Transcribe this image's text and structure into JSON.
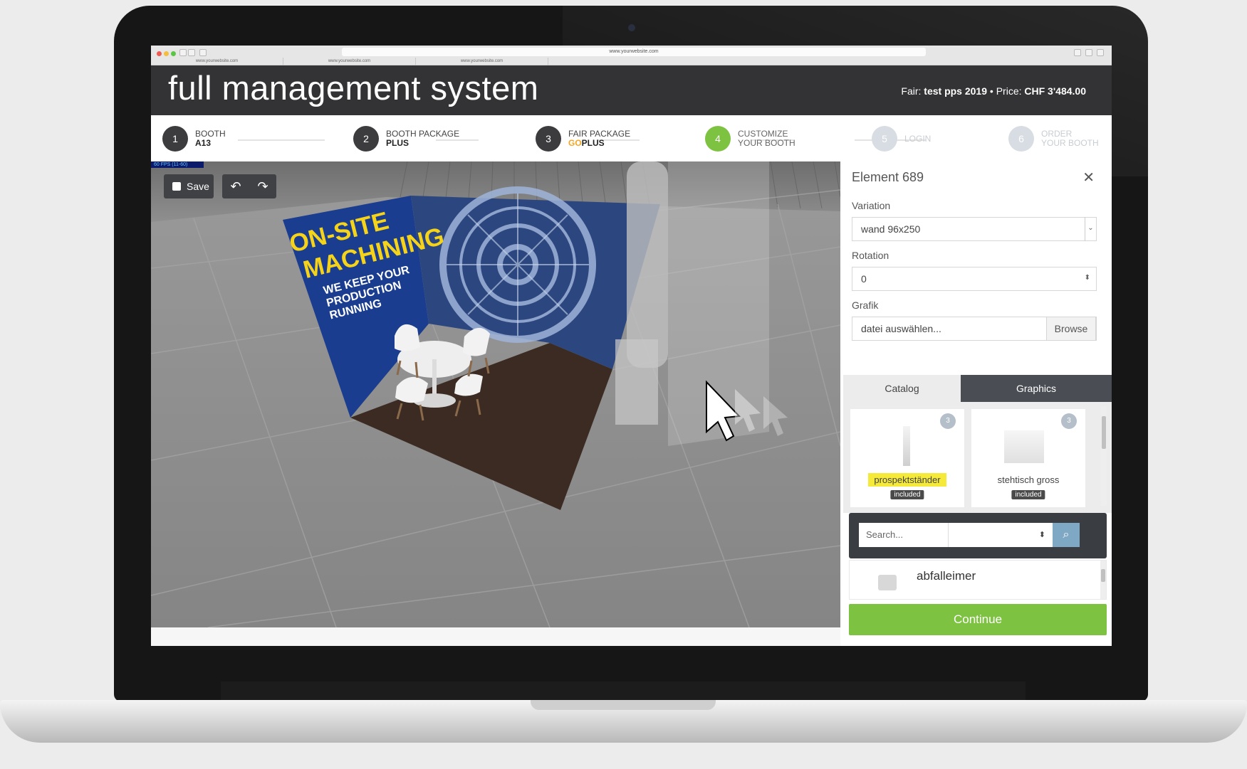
{
  "browser": {
    "url": "www.yourwebsite.com",
    "tabs": [
      "www.yourwebsite.com",
      "www.yourwebsite.com",
      "www.yourwebsite.com"
    ]
  },
  "header": {
    "title": "full management system",
    "fair_label": "Fair:",
    "fair_name": "test pps 2019",
    "separator": "•",
    "price_label": "Price:",
    "price": "CHF 3'484.00"
  },
  "steps": [
    {
      "num": "1",
      "label": "BOOTH",
      "sub": "A13",
      "state": "done"
    },
    {
      "num": "2",
      "label": "BOOTH PACKAGE",
      "sub": "PLUS",
      "state": "done"
    },
    {
      "num": "3",
      "label": "FAIR PACKAGE",
      "sub_prefix": "GO",
      "sub": "PLUS",
      "state": "done"
    },
    {
      "num": "4",
      "label": "CUSTOMIZE",
      "sub": "YOUR BOOTH",
      "state": "current"
    },
    {
      "num": "5",
      "label": "LOGIN",
      "sub": "",
      "state": "future"
    },
    {
      "num": "6",
      "label": "ORDER",
      "sub": "YOUR BOOTH",
      "state": "future"
    }
  ],
  "viewport": {
    "fps": "60 FPS (11-60)",
    "save_label": "Save",
    "banner": {
      "headline_1": "ON-SITE",
      "headline_2": "MACHINING",
      "tagline_1": "WE KEEP YOUR",
      "tagline_2": "PRODUCTION",
      "tagline_3": "RUNNING"
    }
  },
  "panel": {
    "title": "Element 689",
    "variation_label": "Variation",
    "variation_value": "wand 96x250",
    "rotation_label": "Rotation",
    "rotation_value": "0",
    "graphic_label": "Grafik",
    "graphic_placeholder": "datei auswählen...",
    "browse_label": "Browse",
    "tabs": [
      "Catalog",
      "Graphics"
    ],
    "catalog": [
      {
        "name": "prospektständer",
        "badge": "3",
        "tag": "included",
        "highlight": true
      },
      {
        "name": "stehtisch gross",
        "badge": "3",
        "tag": "included",
        "highlight": false
      }
    ],
    "search_placeholder": "Search...",
    "list": [
      {
        "name": "abfalleimer"
      }
    ],
    "continue_label": "Continue"
  },
  "colors": {
    "header_bg": "#333335",
    "accent_green": "#7ec242",
    "highlight_yellow": "#f5e93a",
    "banner_blue": "#1b3d8f",
    "banner_yellow": "#f5d31a"
  }
}
